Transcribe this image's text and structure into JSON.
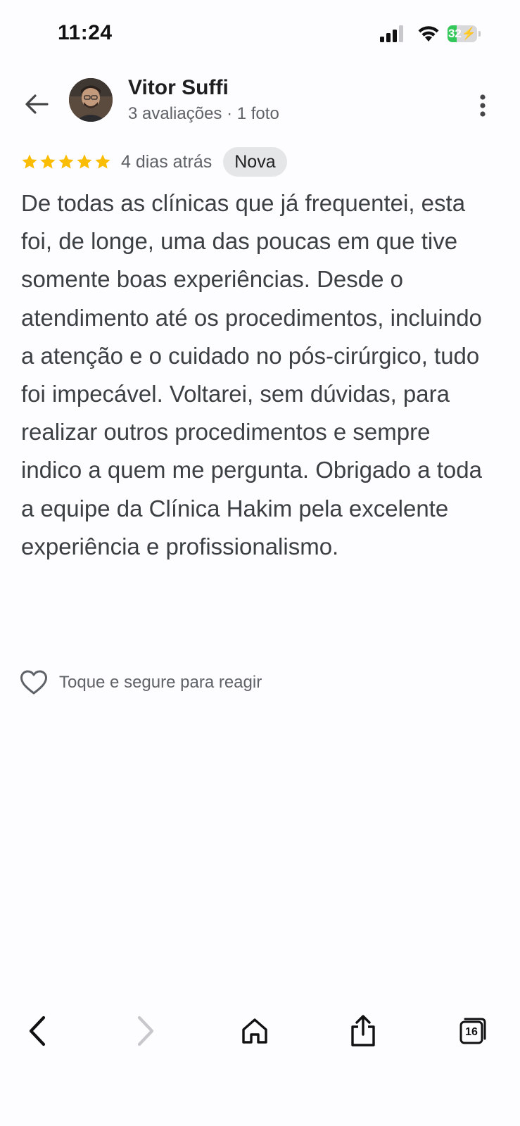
{
  "status_bar": {
    "time": "11:24",
    "battery_level": "32",
    "battery_charging": true,
    "battery_color": "#34c759"
  },
  "header": {
    "back_icon": "arrow-left-icon",
    "user_name": "Vitor Suffi",
    "user_meta": "3 avaliações · 1 foto",
    "more_icon": "more-vertical-icon"
  },
  "review": {
    "rating": 5,
    "rating_max": 5,
    "star_color": "#fbbc04",
    "date": "4 dias atrás",
    "badge": "Nova",
    "text": "De todas as clínicas que já frequentei, esta foi, de longe, uma das poucas em que tive somente boas experiências. Desde o atendimento até os procedimentos, incluindo a atenção e o cuidado no pós-cirúrgico, tudo foi impecável. Voltarei, sem dúvidas, para realizar outros procedimentos e sempre indico a quem me pergunta. Obrigado a toda a equipe da Clínica Hakim pela excelente experiência e profissionalismo."
  },
  "reaction": {
    "icon": "heart-outline-icon",
    "label": "Toque e segure para reagir"
  },
  "browser_toolbar": {
    "back_icon": "chevron-left-icon",
    "forward_icon": "chevron-right-icon",
    "forward_enabled": false,
    "home_icon": "home-icon",
    "share_icon": "share-icon",
    "tabs_icon": "tabs-icon",
    "tabs_count": "16"
  }
}
